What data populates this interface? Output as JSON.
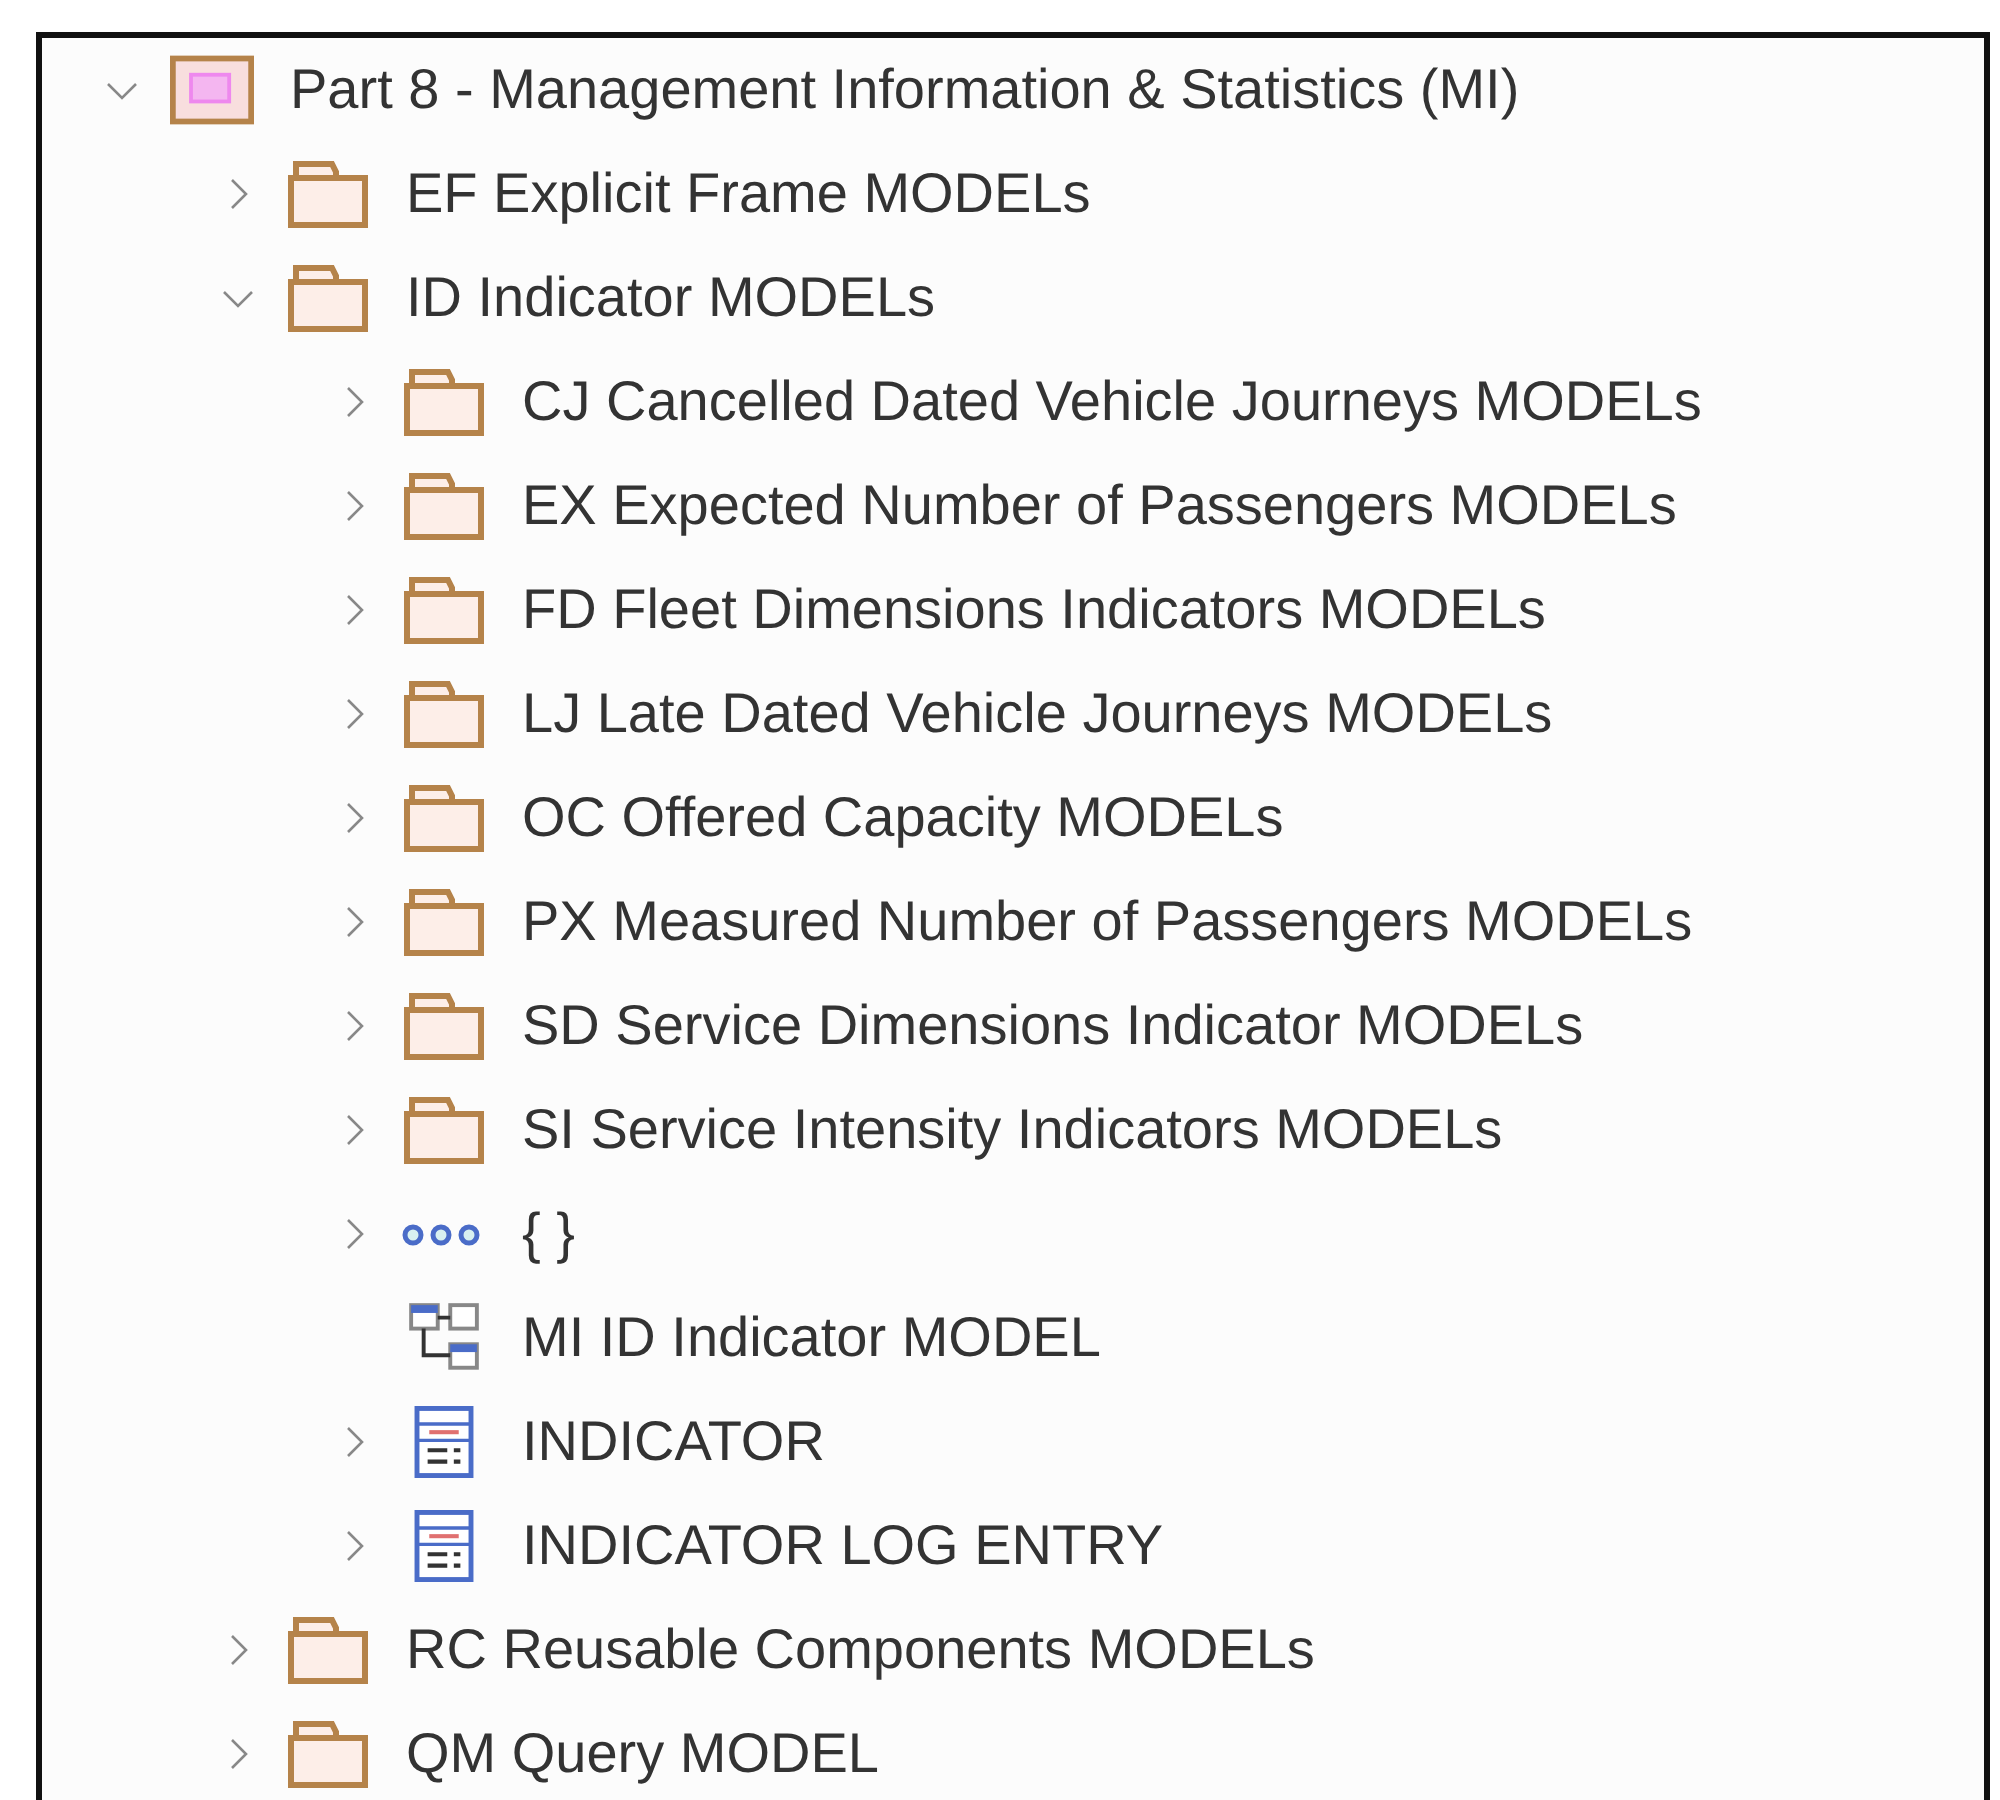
{
  "tree": [
    {
      "kind": "package",
      "label": "Part 8 - Management Information & Statistics (MI)",
      "expanded": true,
      "children": [
        {
          "kind": "folder",
          "label": "EF Explicit Frame MODELs",
          "expanded": false
        },
        {
          "kind": "folder",
          "label": "ID Indicator MODELs",
          "expanded": true,
          "children": [
            {
              "kind": "folder",
              "label": "CJ Cancelled Dated Vehicle Journeys MODELs",
              "expanded": false
            },
            {
              "kind": "folder",
              "label": "EX Expected Number of Passengers MODELs",
              "expanded": false
            },
            {
              "kind": "folder",
              "label": "FD Fleet Dimensions Indicators MODELs",
              "expanded": false
            },
            {
              "kind": "folder",
              "label": "LJ Late Dated Vehicle Journeys MODELs",
              "expanded": false
            },
            {
              "kind": "folder",
              "label": "OC Offered Capacity MODELs",
              "expanded": false
            },
            {
              "kind": "folder",
              "label": "PX Measured Number of Passengers MODELs",
              "expanded": false
            },
            {
              "kind": "folder",
              "label": "SD Service Dimensions Indicator MODELs",
              "expanded": false
            },
            {
              "kind": "folder",
              "label": "SI Service Intensity Indicators MODELs",
              "expanded": false
            },
            {
              "kind": "enumeration",
              "label": "{ }",
              "expanded": false
            },
            {
              "kind": "diagram",
              "label": "MI ID Indicator MODEL"
            },
            {
              "kind": "class",
              "label": "INDICATOR",
              "expanded": false
            },
            {
              "kind": "class",
              "label": "INDICATOR LOG ENTRY",
              "expanded": false
            }
          ]
        },
        {
          "kind": "folder",
          "label": "RC Reusable Components MODELs",
          "expanded": false
        },
        {
          "kind": "folder",
          "label": "QM Query MODEL",
          "expanded": false
        }
      ]
    }
  ]
}
